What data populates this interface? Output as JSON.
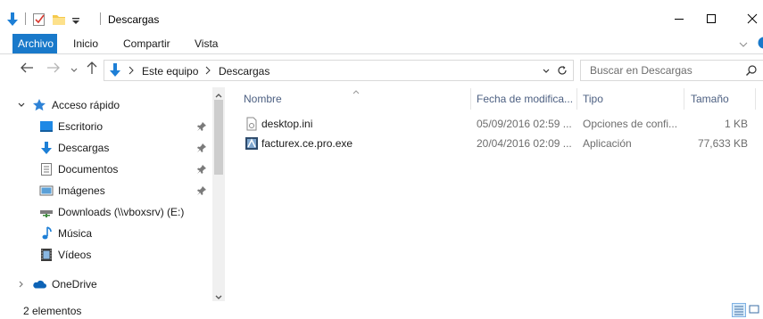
{
  "window": {
    "title": "Descargas"
  },
  "ribbon": {
    "tabs": [
      "Archivo",
      "Inicio",
      "Compartir",
      "Vista"
    ],
    "active_color": "#1979ca"
  },
  "address": {
    "crumbs": [
      "Este equipo",
      "Descargas"
    ],
    "search_placeholder": "Buscar en Descargas"
  },
  "nav": {
    "quick_access": "Acceso rápido",
    "items": [
      {
        "label": "Escritorio",
        "icon": "desktop-icon",
        "pinned": true
      },
      {
        "label": "Descargas",
        "icon": "download-arrow-icon",
        "pinned": true
      },
      {
        "label": "Documentos",
        "icon": "document-icon",
        "pinned": true
      },
      {
        "label": "Imágenes",
        "icon": "pictures-icon",
        "pinned": true
      },
      {
        "label": "Downloads (\\\\vboxsrv) (E:)",
        "icon": "network-drive-icon",
        "pinned": false
      },
      {
        "label": "Música",
        "icon": "music-note-icon",
        "pinned": false
      },
      {
        "label": "Vídeos",
        "icon": "video-icon",
        "pinned": false
      }
    ],
    "onedrive": "OneDrive"
  },
  "columns": [
    "Nombre",
    "Fecha de modifica...",
    "Tipo",
    "Tamaño"
  ],
  "files": [
    {
      "name": "desktop.ini",
      "date": "05/09/2016 02:59 ...",
      "type": "Opciones de confi...",
      "size": "1 KB",
      "icon": "ini-file-icon"
    },
    {
      "name": "facturex.ce.pro.exe",
      "date": "20/04/2016 02:09 ...",
      "type": "Aplicación",
      "size": "77,633 KB",
      "icon": "exe-app-icon"
    }
  ],
  "status": {
    "count": "2 elementos"
  },
  "colors": {
    "accent": "#1979ca",
    "header_text": "#4d6082"
  }
}
